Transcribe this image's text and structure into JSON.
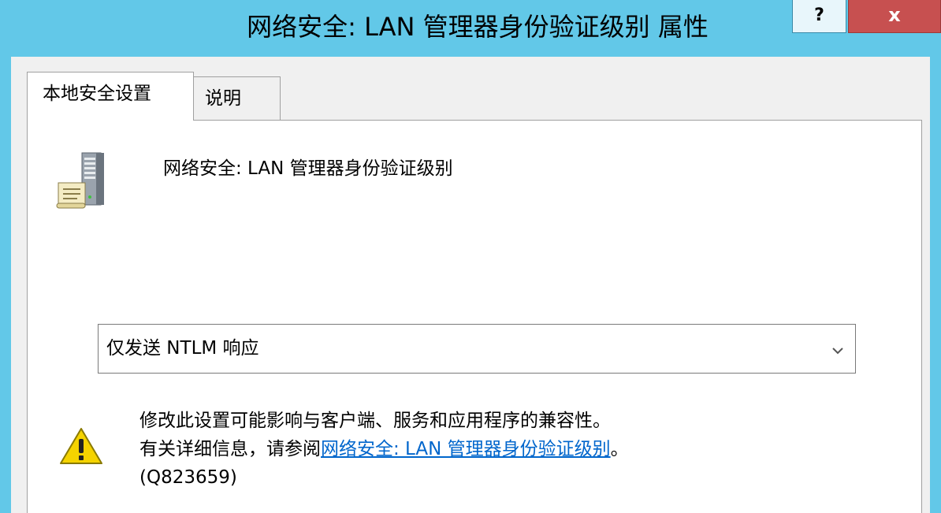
{
  "window": {
    "title": "网络安全: LAN 管理器身份验证级别 属性",
    "help_label": "?",
    "close_label": "x"
  },
  "tabs": [
    {
      "label": "本地安全设置",
      "active": true
    },
    {
      "label": "说明",
      "active": false
    }
  ],
  "policy": {
    "icon": "server-icon",
    "name": "网络安全: LAN 管理器身份验证级别"
  },
  "dropdown": {
    "selected": "仅发送 NTLM 响应",
    "arrow_icon": "chevron-down-icon"
  },
  "warning": {
    "icon": "warning-icon",
    "line1": "修改此设置可能影响与客户端、服务和应用程序的兼容性。",
    "line2_prefix": "有关详细信息，请参阅",
    "link_text": "网络安全: LAN 管理器身份验证级别",
    "line2_suffix": "。",
    "line3": "(Q823659)"
  },
  "colors": {
    "titlebar": "#62c8e8",
    "close_button": "#c75050",
    "link": "#0066cc"
  }
}
